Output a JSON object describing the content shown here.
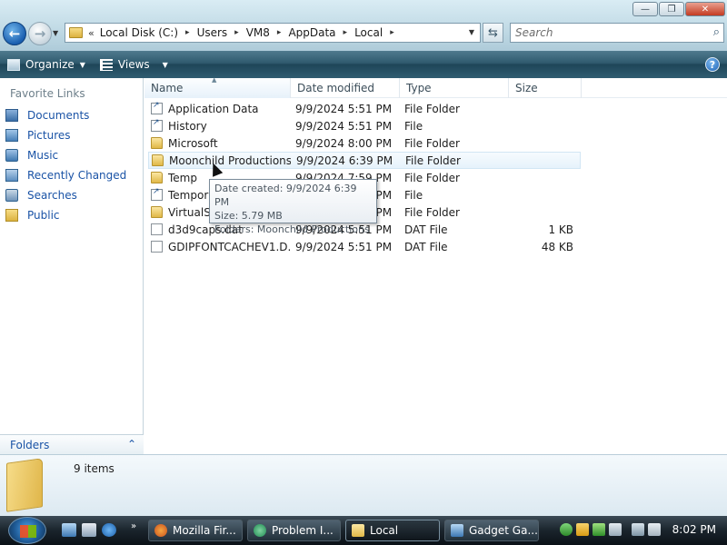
{
  "window": {
    "minimize": "—",
    "maximize": "❐",
    "close": "✕"
  },
  "address": {
    "overflow": "«",
    "crumbs": [
      "Local Disk (C:)",
      "Users",
      "VM8",
      "AppData",
      "Local"
    ],
    "separator": "▸"
  },
  "search": {
    "placeholder": "Search"
  },
  "commands": {
    "organize": "Organize",
    "views": "Views",
    "help": "?"
  },
  "nav": {
    "heading": "Favorite Links",
    "items": [
      "Documents",
      "Pictures",
      "Music",
      "Recently Changed",
      "Searches",
      "Public"
    ],
    "folders_label": "Folders"
  },
  "columns": {
    "name": "Name",
    "date": "Date modified",
    "type": "Type",
    "size": "Size"
  },
  "files": [
    {
      "name": "Application Data",
      "date": "9/9/2024 5:51 PM",
      "type": "File Folder",
      "size": "",
      "icon": "shortcut-icon"
    },
    {
      "name": "History",
      "date": "9/9/2024 5:51 PM",
      "type": "File",
      "size": "",
      "icon": "shortcut-icon"
    },
    {
      "name": "Microsoft",
      "date": "9/9/2024 8:00 PM",
      "type": "File Folder",
      "size": "",
      "icon": "folder-icon"
    },
    {
      "name": "Moonchild Productions",
      "date": "9/9/2024 6:39 PM",
      "type": "File Folder",
      "size": "",
      "icon": "folder-icon"
    },
    {
      "name": "Temp",
      "date": "9/9/2024 7:59 PM",
      "type": "File Folder",
      "size": "",
      "icon": "folder-icon"
    },
    {
      "name": "Temporary Internet Files",
      "date": "9/9/2024 5:51 PM",
      "type": "File",
      "size": "",
      "icon": "shortcut-icon"
    },
    {
      "name": "VirtualStore",
      "date": "9/9/2024 5:51 PM",
      "type": "File Folder",
      "size": "",
      "icon": "folder-icon"
    },
    {
      "name": "d3d9caps.dat",
      "date": "9/9/2024 5:51 PM",
      "type": "DAT File",
      "size": "1 KB",
      "icon": "file-icon"
    },
    {
      "name": "GDIPFONTCACHEV1.D...",
      "date": "9/9/2024 5:51 PM",
      "type": "DAT File",
      "size": "48 KB",
      "icon": "file-icon"
    }
  ],
  "tooltip": {
    "line1": "Date created: 9/9/2024 6:39 PM",
    "line2": "Size: 5.79 MB",
    "line3": "Folders: Moonchild Productions"
  },
  "details": {
    "items": "9 items"
  },
  "taskbar": {
    "quicklaunch_more": "»",
    "tasks": [
      "Mozilla Fir...",
      "Problem I...",
      "Local",
      "Gadget Ga..."
    ],
    "clock": "8:02 PM"
  }
}
